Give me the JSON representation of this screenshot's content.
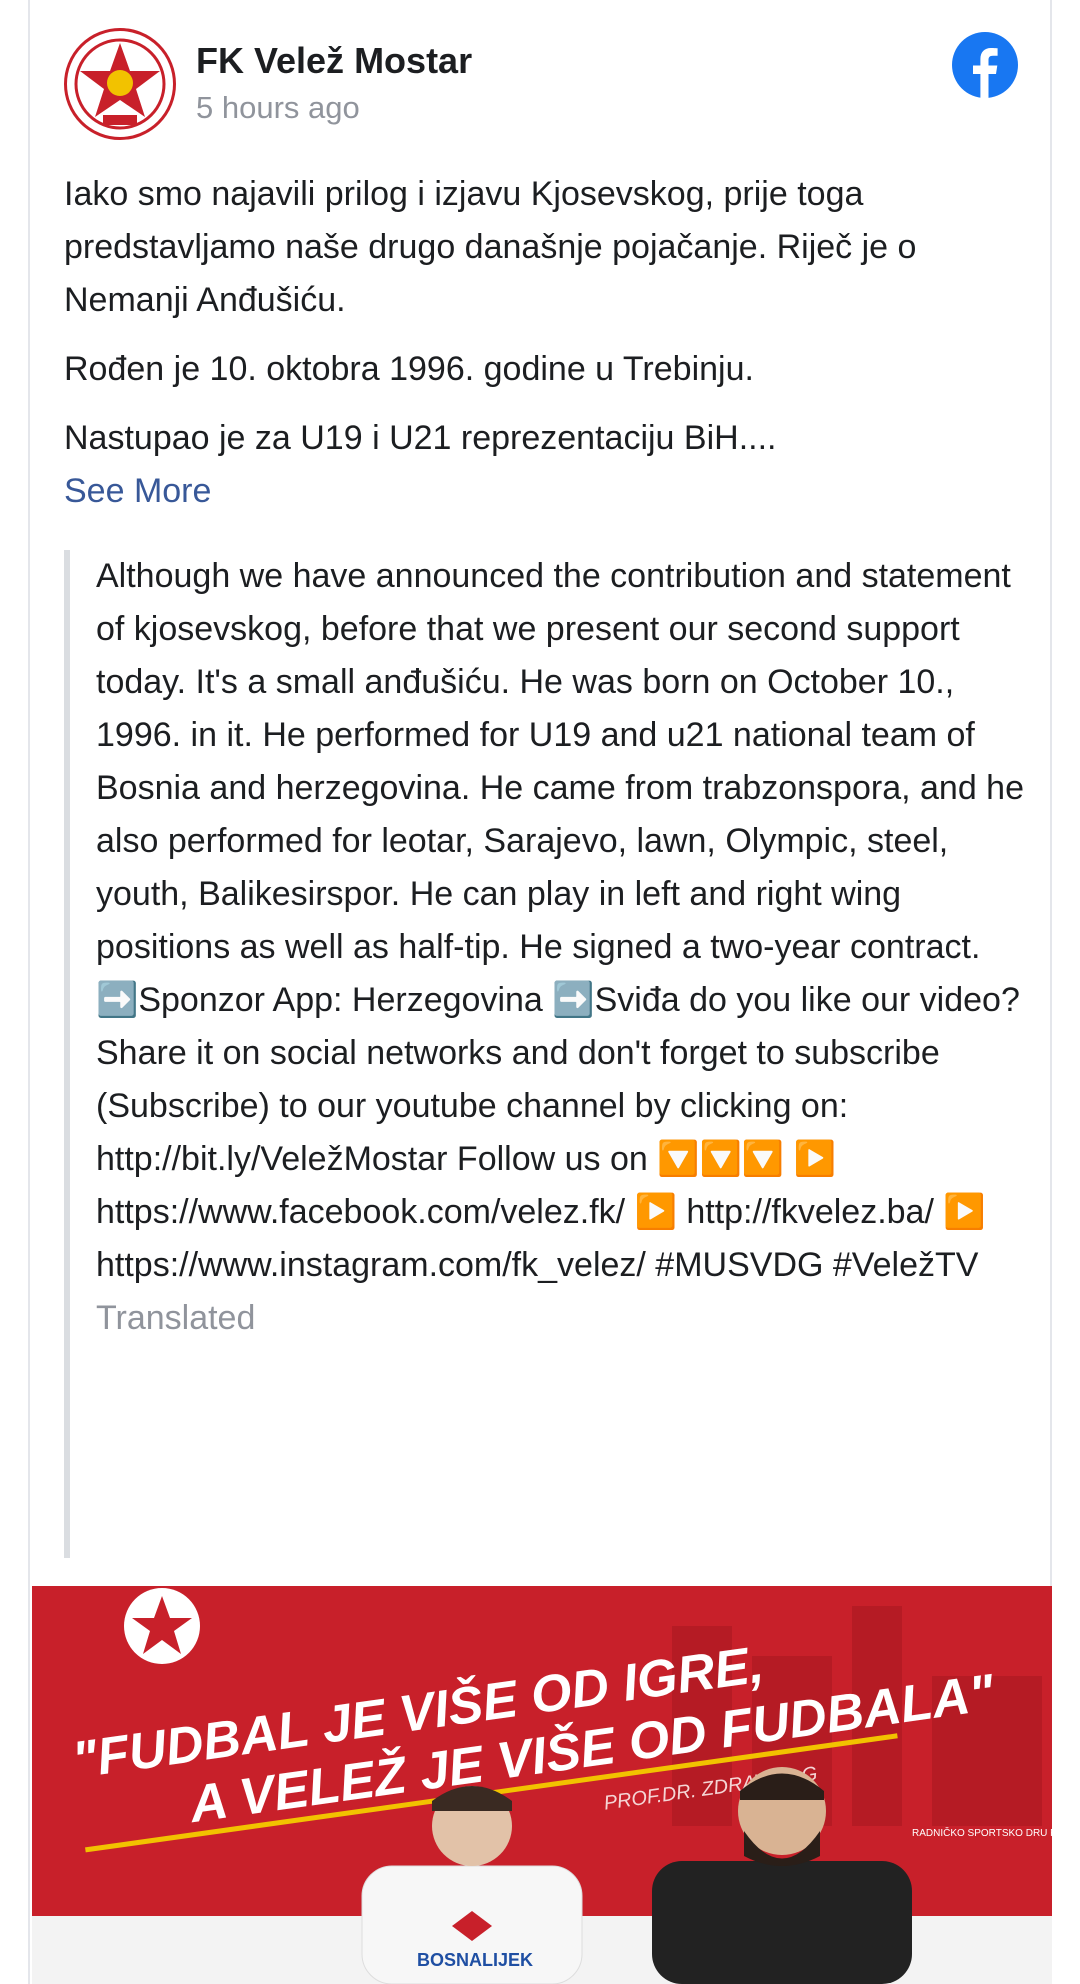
{
  "post": {
    "page_name": "FK Velež Mostar",
    "timestamp": "5 hours ago",
    "paragraphs": [
      "Iako smo najavili prilog i izjavu Kjosevskog, prije toga predstavljamo naše drugo današnje pojačanje. Riječ je o Nemanji Anđušiću.",
      "Rođen je 10. oktobra 1996. godine u Trebinju.",
      "Nastupao je za U19 i U21 reprezentaciju BiH...."
    ],
    "see_more_label": "See More",
    "translation": "Although we have announced the contribution and statement of kjosevskog, before that we present our second support today. It's a small anđušiću. He was born on October 10., 1996. in it. He performed for U19 and u21 national team of Bosnia and herzegovina. He came from trabzonspora, and he also performed for leotar, Sarajevo, lawn, Olympic, steel, youth, Balikesirspor. He can play in left and right wing positions as well as half-tip. He signed a two-year contract. ➡️Sponzor App: Herzegovina ➡️Sviđa do you like our video? Share it on social networks and don't forget to subscribe (Subscribe) to our youtube channel by clicking on: http://bit.ly/VeležMostar Follow us on 🔽🔽🔽 ▶️ https://www.facebook.com/velez.fk/ ▶️ http://fkvelez.ba/ ▶️ https://www.instagram.com/fk_velez/ #MUSVDG #VeležTV",
    "translated_label": "Translated"
  },
  "media": {
    "headline_line1": "\"FUDBAL JE VIŠE OD IGRE,",
    "headline_line2": "A VELEŽ JE VIŠE OD FUDBALA\"",
    "attribution": "PROF.DR. ZDRAVKO G",
    "sponsor": "BOSNALIJEK",
    "club_text": "RADNIČKO SPORTSKO DRU FUDBALSKI KLUB \"VELEŽ\" MO OSN"
  },
  "colors": {
    "brand_red": "#c8202a",
    "facebook_blue": "#1877f2",
    "link_blue": "#385898",
    "muted_gray": "#90949c"
  }
}
